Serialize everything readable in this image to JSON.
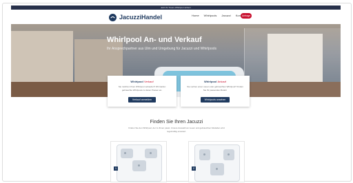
{
  "topbar": {
    "text": "Jetzt Ihr Traum-Whirlpool sichern"
  },
  "nav": {
    "logo_text": "JacuzziHandel",
    "links": [
      "Home",
      "Whirlpools",
      "Jacuzzi",
      "Kontakt"
    ],
    "cta_label": "Anfrage"
  },
  "hero": {
    "title": "Whirlpool An- und Verkauf",
    "subtitle": "Ihr Ansprechpartner aus Ulm und Umgebung für Jacuzzi und Whirlpools"
  },
  "cards": [
    {
      "title": "Whirlpool",
      "accent": "Verkauf",
      "text": "Sie möchten Ihren Whirlpool verkaufen? Wir kaufen gebrauchte Whirlpools zu fairen Preisen an.",
      "button": "Verkauf anmelden"
    },
    {
      "title": "Whirlpool",
      "accent": "Ankauf",
      "text": "Sie suchen einen neuen oder gebrauchten Whirlpool? Finden Sie Ihr passendes Modell.",
      "button": "Whirlpools ansehen"
    }
  ],
  "section": {
    "title": "Finden Sie Ihren Jacuzzi",
    "text": "Finden Sie den Whirlpool, der zu Ihnen passt. Unsere Auswahl an neuen und gebrauchten Modellen wird regelmäßig erweitert."
  },
  "products": [
    {
      "badge": "1"
    },
    {
      "badge": "2"
    }
  ],
  "colors": {
    "brand": "#1f3a5f",
    "accent": "#c8102e"
  }
}
